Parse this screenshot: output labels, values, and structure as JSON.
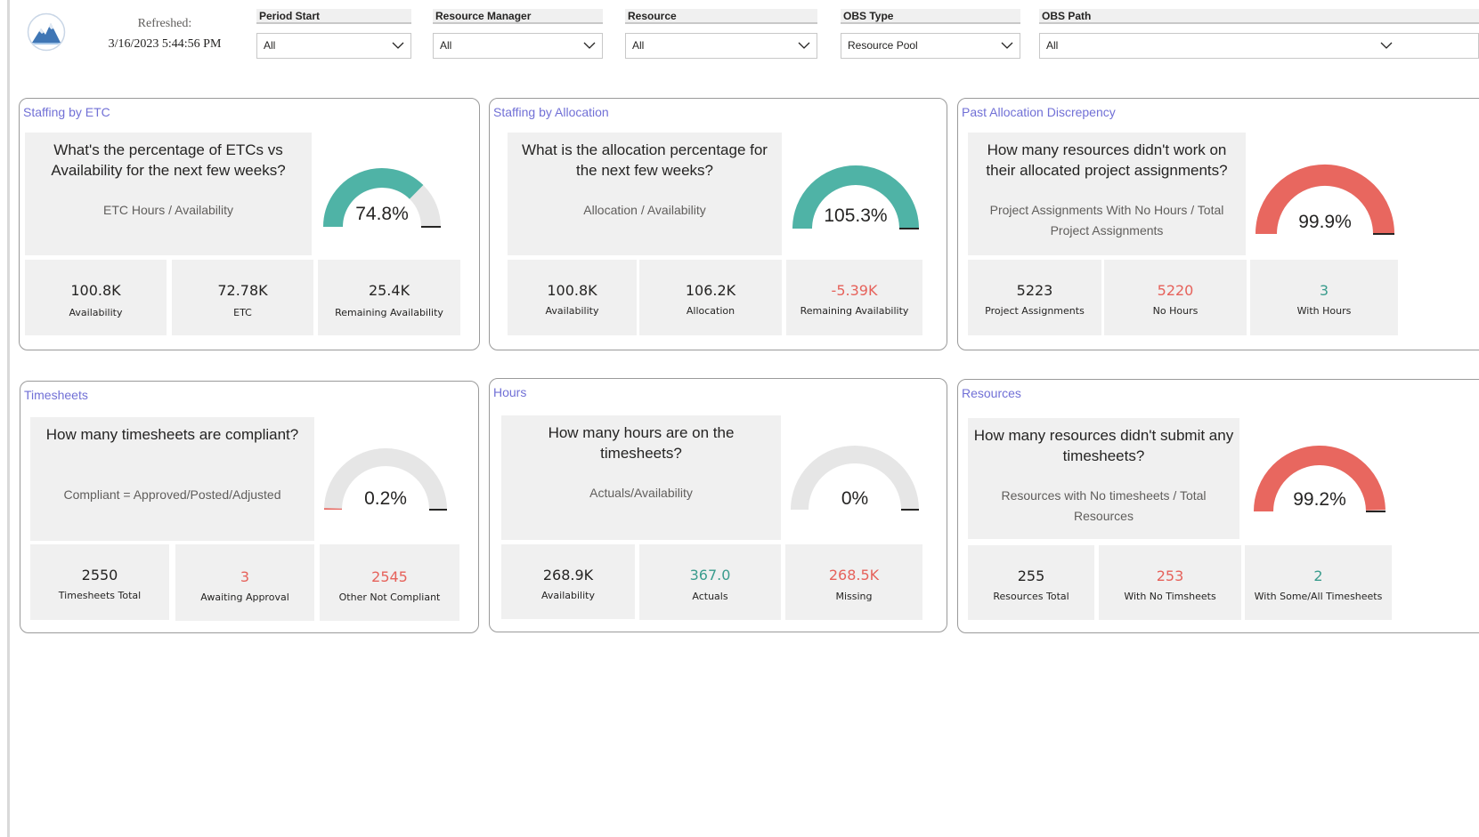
{
  "header": {
    "refreshed_label": "Refreshed:",
    "refreshed_value": "3/16/2023 5:44:56 PM",
    "logo_icon": "mountain-logo-icon"
  },
  "filters": [
    {
      "title": "Period Start",
      "value": "All"
    },
    {
      "title": "Resource Manager",
      "value": "All"
    },
    {
      "title": "Resource",
      "value": "All"
    },
    {
      "title": "OBS Type",
      "value": "Resource Pool"
    },
    {
      "title": "OBS Path",
      "value": "All"
    }
  ],
  "colors": {
    "teal": "#4fb3a6",
    "red": "#e8675f",
    "gauge_bg": "#e6e6e6",
    "title": "#7170d6"
  },
  "cards": [
    {
      "title": "Staffing by ETC",
      "question": "What's the percentage of ETCs vs Availability for the next few weeks?",
      "formula": "ETC Hours / Availability",
      "gauge": {
        "value_text": "74.8%",
        "fraction": 0.748,
        "color": "#4fb3a6"
      },
      "kpis": [
        {
          "value": "100.8K",
          "label": "Availability",
          "tone": "dark"
        },
        {
          "value": "72.78K",
          "label": "ETC",
          "tone": "dark"
        },
        {
          "value": "25.4K",
          "label": "Remaining Availability",
          "tone": "dark"
        }
      ]
    },
    {
      "title": "Staffing by Allocation",
      "question": "What is the allocation percentage for the next few weeks?",
      "formula": "Allocation / Availability",
      "gauge": {
        "value_text": "105.3%",
        "fraction": 1.0,
        "color": "#4fb3a6"
      },
      "kpis": [
        {
          "value": "100.8K",
          "label": "Availability",
          "tone": "dark"
        },
        {
          "value": "106.2K",
          "label": "Allocation",
          "tone": "dark"
        },
        {
          "value": "-5.39K",
          "label": "Remaining Availability",
          "tone": "red"
        }
      ]
    },
    {
      "title": "Past Allocation Discrepency",
      "question": "How many resources didn't work on their allocated project assignments?",
      "formula": "Project Assignments With No Hours / Total Project Assignments",
      "gauge": {
        "value_text": "99.9%",
        "fraction": 0.999,
        "color": "#e8675f"
      },
      "kpis": [
        {
          "value": "5223",
          "label": "Project Assignments",
          "tone": "dark"
        },
        {
          "value": "5220",
          "label": "No Hours",
          "tone": "red"
        },
        {
          "value": "3",
          "label": "With Hours",
          "tone": "teal"
        }
      ]
    },
    {
      "title": "Timesheets",
      "question": "How many timesheets are compliant?",
      "formula": "Compliant = Approved/Posted/Adjusted",
      "gauge": {
        "value_text": "0.2%",
        "fraction": 0.002,
        "color": "#e8675f"
      },
      "kpis": [
        {
          "value": "2550",
          "label": "Timesheets Total",
          "tone": "dark"
        },
        {
          "value": "3",
          "label": "Awaiting Approval",
          "tone": "red"
        },
        {
          "value": "2545",
          "label": "Other Not Compliant",
          "tone": "red"
        }
      ]
    },
    {
      "title": "Hours",
      "question": "How many hours are on the timesheets?",
      "formula": "Actuals/Availability",
      "gauge": {
        "value_text": "0%",
        "fraction": 0.0,
        "color": "#4fb3a6"
      },
      "kpis": [
        {
          "value": "268.9K",
          "label": "Availability",
          "tone": "dark"
        },
        {
          "value": "367.0",
          "label": "Actuals",
          "tone": "teal"
        },
        {
          "value": "268.5K",
          "label": "Missing",
          "tone": "red"
        }
      ]
    },
    {
      "title": "Resources",
      "question": "How many resources didn't submit any timesheets?",
      "formula": "Resources with No timesheets / Total Resources",
      "gauge": {
        "value_text": "99.2%",
        "fraction": 0.992,
        "color": "#e8675f"
      },
      "kpis": [
        {
          "value": "255",
          "label": "Resources Total",
          "tone": "dark"
        },
        {
          "value": "253",
          "label": "With No Timsheets",
          "tone": "red"
        },
        {
          "value": "2",
          "label": "With Some/All Timesheets",
          "tone": "teal"
        }
      ]
    }
  ]
}
